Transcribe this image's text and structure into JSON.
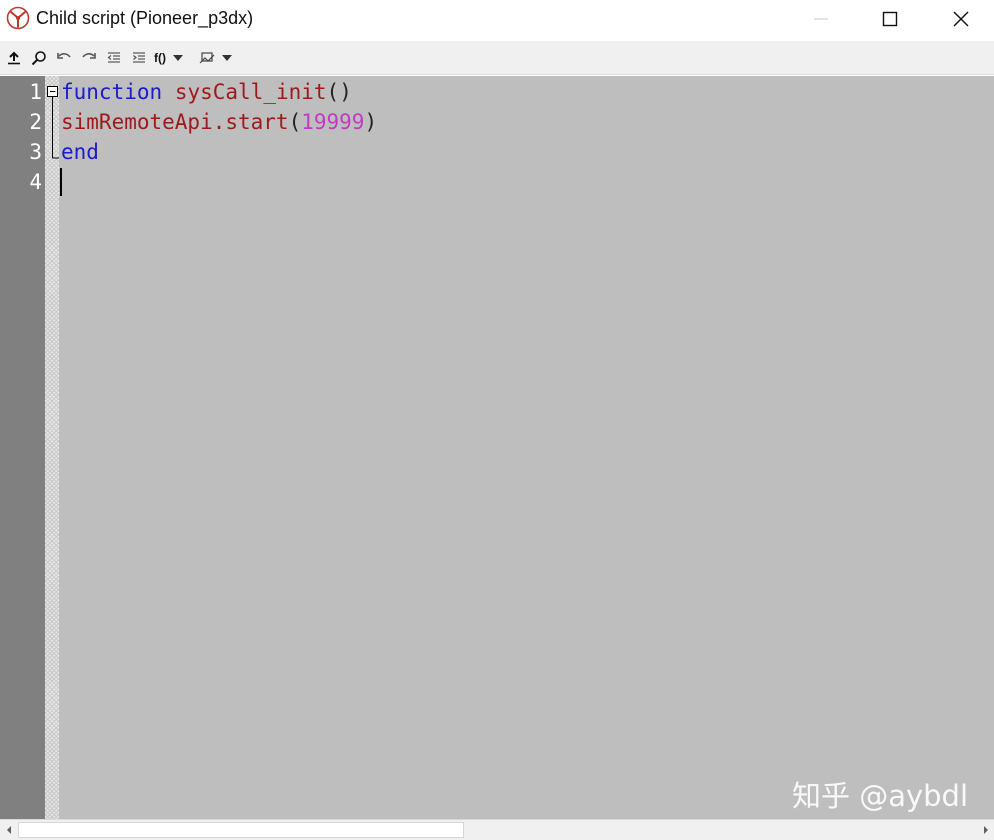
{
  "window": {
    "title": "Child script (Pioneer_p3dx)"
  },
  "toolbar": {
    "function_label": "f()"
  },
  "editor": {
    "line_numbers": [
      "1",
      "2",
      "3",
      "4"
    ],
    "lines": [
      {
        "keyword": "function",
        "name": "sysCall_init",
        "paren_open": "(",
        "paren_close": ")"
      },
      {
        "name": "simRemoteApi.start",
        "paren_open": "(",
        "number": "19999",
        "paren_close": ")"
      },
      {
        "keyword": "end"
      },
      {
        "text": ""
      }
    ]
  },
  "watermark": {
    "text": "知乎 @aybdl"
  },
  "colors": {
    "keyword": "#1b1bcc",
    "identifier": "#9e1a1a",
    "number": "#c23ac2",
    "editor_bg": "#bebebe",
    "gutter_bg": "#808080"
  }
}
